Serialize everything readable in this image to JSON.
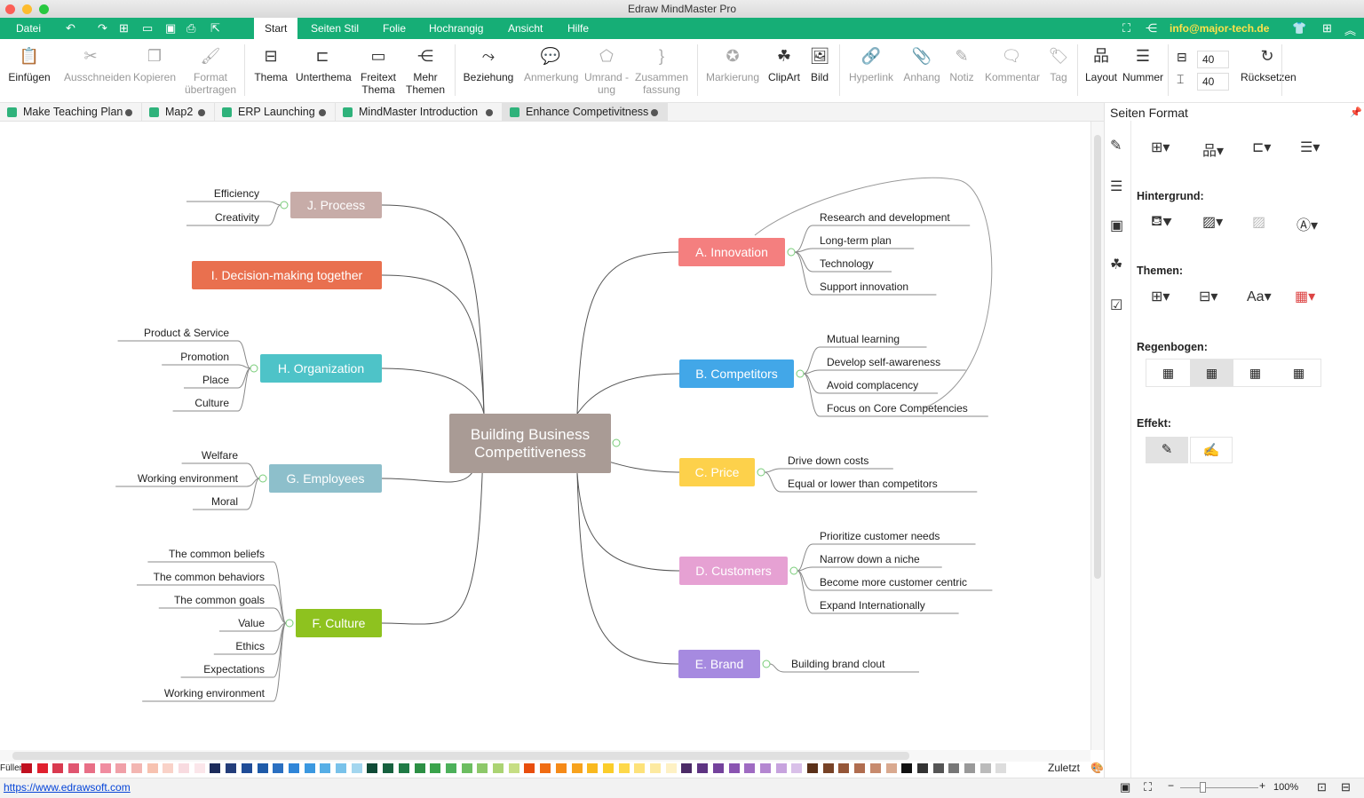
{
  "window": {
    "title": "Edraw MindMaster Pro"
  },
  "menu": {
    "file": "Datei",
    "tabs": [
      "Start",
      "Seiten Stil",
      "Folie",
      "Hochrangig",
      "Ansicht",
      "Hilfe"
    ],
    "account": "info@major-tech.de"
  },
  "ribbon": {
    "buttons": [
      {
        "label": "Einfügen",
        "icon": "clipboard-icon",
        "disabled": false
      },
      {
        "label": "Ausschneiden",
        "icon": "scissors-icon",
        "disabled": true
      },
      {
        "label": "Kopieren",
        "icon": "copy-icon",
        "disabled": true
      },
      {
        "label": "Format übertragen",
        "icon": "format-painter-icon",
        "disabled": true
      },
      {
        "label": "Thema",
        "icon": "topic-icon",
        "disabled": false
      },
      {
        "label": "Unterthema",
        "icon": "subtopic-icon",
        "disabled": false
      },
      {
        "label": "Freitext Thema",
        "icon": "floating-topic-icon",
        "disabled": false
      },
      {
        "label": "Mehr Themen",
        "icon": "more-topics-icon",
        "disabled": false
      },
      {
        "label": "Beziehung",
        "icon": "relationship-icon",
        "disabled": false
      },
      {
        "label": "Anmerkung",
        "icon": "callout-icon",
        "disabled": true
      },
      {
        "label": "Umrand -ung",
        "icon": "boundary-icon",
        "disabled": true
      },
      {
        "label": "Zusammen fassung",
        "icon": "summary-icon",
        "disabled": true
      },
      {
        "label": "Markierung",
        "icon": "mark-icon",
        "disabled": true
      },
      {
        "label": "ClipArt",
        "icon": "clipart-icon",
        "disabled": false
      },
      {
        "label": "Bild",
        "icon": "image-icon",
        "disabled": false
      },
      {
        "label": "Hyperlink",
        "icon": "hyperlink-icon",
        "disabled": true
      },
      {
        "label": "Anhang",
        "icon": "attachment-icon",
        "disabled": true
      },
      {
        "label": "Notiz",
        "icon": "note-icon",
        "disabled": true
      },
      {
        "label": "Kommentar",
        "icon": "comment-icon",
        "disabled": true
      },
      {
        "label": "Tag",
        "icon": "tag-icon",
        "disabled": true
      },
      {
        "label": "Layout",
        "icon": "layout-icon",
        "disabled": false
      },
      {
        "label": "Nummer",
        "icon": "numbering-icon",
        "disabled": false
      },
      {
        "label": "Rücksetzen",
        "icon": "reset-icon",
        "disabled": false
      }
    ],
    "h_spacing": "40",
    "v_spacing": "40"
  },
  "doc_tabs": [
    "Make Teaching Plan",
    "Map2",
    "ERP Launching",
    "MindMaster Introduction",
    "Enhance Competivitness"
  ],
  "active_doc_tab": 4,
  "mindmap": {
    "central": "Building Business Competitiveness",
    "topics": [
      {
        "id": "J",
        "label": "J. Process",
        "color": "#c7aca8",
        "children": [
          "Efficiency",
          "Creativity"
        ]
      },
      {
        "id": "I",
        "label": "I. Decision-making together",
        "color": "#e9704f",
        "children": []
      },
      {
        "id": "H",
        "label": "H. Organization",
        "color": "#4ec3c8",
        "children": [
          "Product & Service",
          "Promotion",
          "Place",
          "Culture"
        ]
      },
      {
        "id": "G",
        "label": "G. Employees",
        "color": "#8dbfcb",
        "children": [
          "Welfare",
          "Working environment",
          "Moral"
        ]
      },
      {
        "id": "F",
        "label": "F. Culture",
        "color": "#8ec21f",
        "children": [
          "The common beliefs",
          "The common behaviors",
          "The common goals",
          "Value",
          "Ethics",
          "Expectations",
          "Working environment"
        ]
      },
      {
        "id": "A",
        "label": "A. Innovation",
        "color": "#f47f7f",
        "children": [
          "Research and development",
          "Long-term plan",
          "Technology",
          "Support innovation"
        ]
      },
      {
        "id": "B",
        "label": "B. Competitors",
        "color": "#42a7e8",
        "children": [
          "Mutual learning",
          "Develop self-awareness",
          "Avoid complacency",
          "Focus on Core Competencies"
        ]
      },
      {
        "id": "C",
        "label": "C. Price",
        "color": "#fdd14b",
        "children": [
          "Drive down costs",
          "Equal or lower than competitors"
        ]
      },
      {
        "id": "D",
        "label": "D. Customers",
        "color": "#e6a1d3",
        "children": [
          "Prioritize customer needs",
          "Narrow down a niche",
          "Become more customer centric",
          "Expand Internationally"
        ]
      },
      {
        "id": "E",
        "label": "E. Brand",
        "color": "#a68ae0",
        "children": [
          "Building brand clout"
        ]
      }
    ],
    "central_color": "#a99b95"
  },
  "panel": {
    "title": "Seiten Format",
    "background": "Hintergrund:",
    "themes": "Themen:",
    "rainbow": "Regenbogen:",
    "effect": "Effekt:"
  },
  "palette": {
    "label": "Füllen",
    "recent": "Zuletzt",
    "colors": [
      "#c0101f",
      "#e0202e",
      "#d93a4f",
      "#e05570",
      "#e86f86",
      "#f08ca0",
      "#f0a0a8",
      "#f3b6b2",
      "#f7c2b0",
      "#f9d2c8",
      "#f8dbe0",
      "#fbe6ea",
      "#1c2b5a",
      "#233d7a",
      "#1f4c97",
      "#1e5aa8",
      "#2a6fc1",
      "#2f85d8",
      "#3b98e0",
      "#56aee6",
      "#79c2ea",
      "#a3d6ef",
      "#0f4a36",
      "#17613f",
      "#1f7a45",
      "#2c8f44",
      "#3aa34b",
      "#4cb05a",
      "#6cbd60",
      "#8dc86a",
      "#abd373",
      "#c6de84",
      "#e84e0e",
      "#f06c12",
      "#f58a18",
      "#f7a21d",
      "#f9b91f",
      "#fbcd2a",
      "#fdd84a",
      "#fde27a",
      "#fdeaa1",
      "#fef1c4",
      "#4b2a66",
      "#5e3482",
      "#74429c",
      "#8a54b1",
      "#9f6bc2",
      "#b487d1",
      "#c7a3de",
      "#d9c0e9",
      "#5a3019",
      "#774226",
      "#955638",
      "#b06d4f",
      "#c78a6d",
      "#d9a98f",
      "#111111",
      "#333333",
      "#555555",
      "#777777",
      "#999999",
      "#bbbbbb",
      "#dddddd",
      "#ffffff"
    ]
  },
  "status": {
    "url": "https://www.edrawsoft.com",
    "zoom": "100%",
    "zoom_level": 100
  }
}
